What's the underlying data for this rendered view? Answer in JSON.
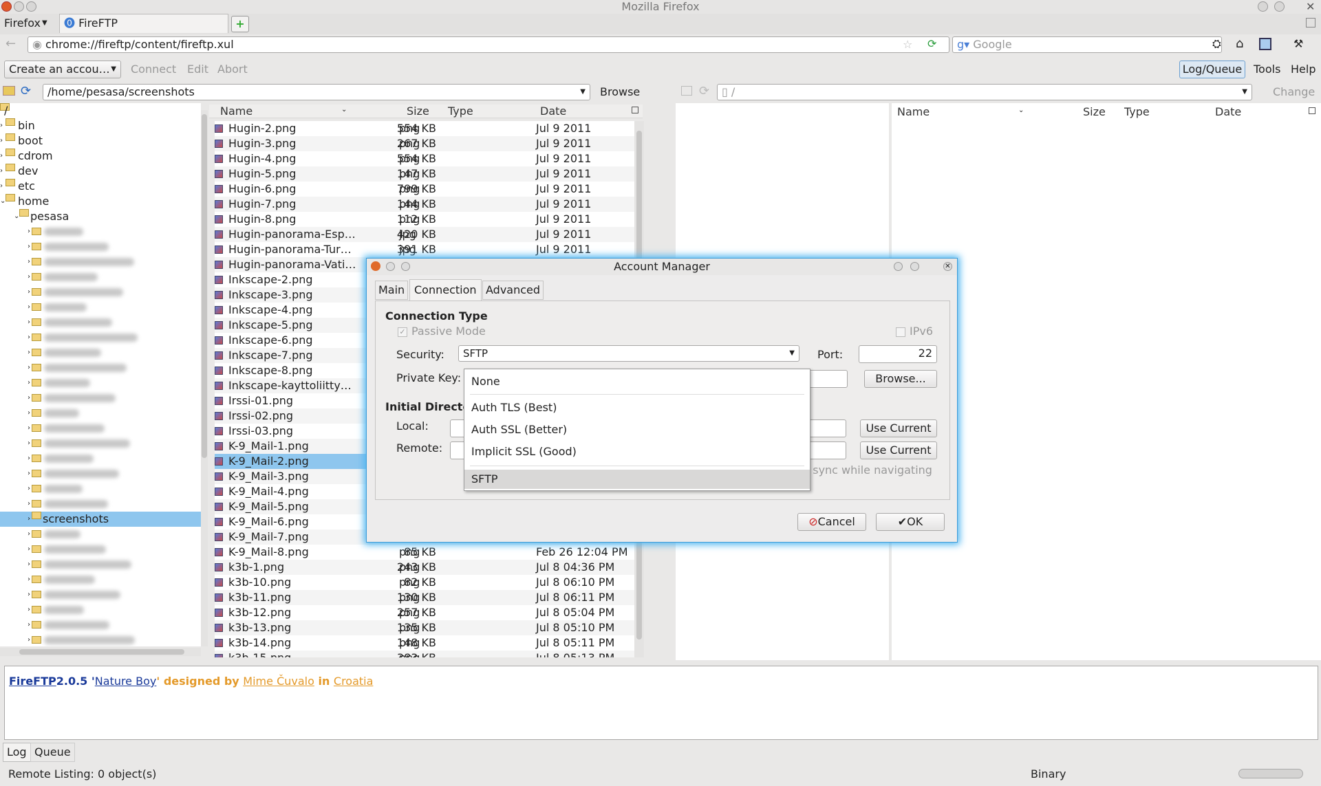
{
  "window": {
    "title": "Mozilla Firefox"
  },
  "browser": {
    "firefox_menu": "Firefox",
    "tab_label": "FireFTP",
    "url": "chrome://fireftp/content/fireftp.xul",
    "search_placeholder": "Google"
  },
  "toolbar": {
    "account_select": "Create an accou…",
    "connect": "Connect",
    "edit": "Edit",
    "abort": "Abort",
    "log_queue": "Log/Queue",
    "tools": "Tools",
    "help": "Help"
  },
  "local": {
    "path": "/home/pesasa/screenshots",
    "browse": "Browse",
    "columns": {
      "name": "Name",
      "size": "Size",
      "type": "Type",
      "date": "Date"
    },
    "tree": {
      "root": "/",
      "bin": "bin",
      "boot": "boot",
      "cdrom": "cdrom",
      "dev": "dev",
      "etc": "etc",
      "home": "home",
      "pesasa": "pesasa",
      "screenshots": "screenshots"
    },
    "files": [
      {
        "name": "Hugin-2.png",
        "size": "554 KB",
        "type": "png",
        "date": "Jul 9 2011"
      },
      {
        "name": "Hugin-3.png",
        "size": "267 KB",
        "type": "png",
        "date": "Jul 9 2011"
      },
      {
        "name": "Hugin-4.png",
        "size": "554 KB",
        "type": "png",
        "date": "Jul 9 2011"
      },
      {
        "name": "Hugin-5.png",
        "size": "147 KB",
        "type": "png",
        "date": "Jul 9 2011"
      },
      {
        "name": "Hugin-6.png",
        "size": "799 KB",
        "type": "png",
        "date": "Jul 9 2011"
      },
      {
        "name": "Hugin-7.png",
        "size": "144 KB",
        "type": "png",
        "date": "Jul 9 2011"
      },
      {
        "name": "Hugin-8.png",
        "size": "112 KB",
        "type": "png",
        "date": "Jul 9 2011"
      },
      {
        "name": "Hugin-panorama-Esp…",
        "size": "420 KB",
        "type": "jpg",
        "date": "Jul 9 2011"
      },
      {
        "name": "Hugin-panorama-Tur…",
        "size": "391 KB",
        "type": "jpg",
        "date": "Jul 9 2011"
      },
      {
        "name": "Hugin-panorama-Vati…",
        "size": "",
        "type": "",
        "date": ""
      },
      {
        "name": "Inkscape-2.png",
        "size": "",
        "type": "",
        "date": ""
      },
      {
        "name": "Inkscape-3.png",
        "size": "",
        "type": "",
        "date": ""
      },
      {
        "name": "Inkscape-4.png",
        "size": "",
        "type": "",
        "date": ""
      },
      {
        "name": "Inkscape-5.png",
        "size": "",
        "type": "",
        "date": ""
      },
      {
        "name": "Inkscape-6.png",
        "size": "",
        "type": "",
        "date": ""
      },
      {
        "name": "Inkscape-7.png",
        "size": "",
        "type": "",
        "date": ""
      },
      {
        "name": "Inkscape-8.png",
        "size": "",
        "type": "",
        "date": ""
      },
      {
        "name": "Inkscape-kayttoliitty…",
        "size": "",
        "type": "",
        "date": ""
      },
      {
        "name": "Irssi-01.png",
        "size": "",
        "type": "",
        "date": ""
      },
      {
        "name": "Irssi-02.png",
        "size": "",
        "type": "",
        "date": ""
      },
      {
        "name": "Irssi-03.png",
        "size": "",
        "type": "",
        "date": ""
      },
      {
        "name": "K-9_Mail-1.png",
        "size": "",
        "type": "",
        "date": ""
      },
      {
        "name": "K-9_Mail-2.png",
        "size": "",
        "type": "",
        "date": ""
      },
      {
        "name": "K-9_Mail-3.png",
        "size": "",
        "type": "",
        "date": ""
      },
      {
        "name": "K-9_Mail-4.png",
        "size": "",
        "type": "",
        "date": ""
      },
      {
        "name": "K-9_Mail-5.png",
        "size": "",
        "type": "",
        "date": ""
      },
      {
        "name": "K-9_Mail-6.png",
        "size": "",
        "type": "",
        "date": ""
      },
      {
        "name": "K-9_Mail-7.png",
        "size": "",
        "type": "",
        "date": ""
      },
      {
        "name": "K-9_Mail-8.png",
        "size": "85 KB",
        "type": "png",
        "date": "Feb 26 12:04 PM"
      },
      {
        "name": "k3b-1.png",
        "size": "243 KB",
        "type": "png",
        "date": "Jul 8 04:36 PM"
      },
      {
        "name": "k3b-10.png",
        "size": "82 KB",
        "type": "png",
        "date": "Jul 8 06:10 PM"
      },
      {
        "name": "k3b-11.png",
        "size": "130 KB",
        "type": "png",
        "date": "Jul 8 06:11 PM"
      },
      {
        "name": "k3b-12.png",
        "size": "257 KB",
        "type": "png",
        "date": "Jul 8 05:04 PM"
      },
      {
        "name": "k3b-13.png",
        "size": "135 KB",
        "type": "png",
        "date": "Jul 8 05:10 PM"
      },
      {
        "name": "k3b-14.png",
        "size": "148 KB",
        "type": "png",
        "date": "Jul 8 05:11 PM"
      },
      {
        "name": "k3b-15.png",
        "size": "383 KB",
        "type": "png",
        "date": "Jul 8 05:13 PM"
      }
    ]
  },
  "remote": {
    "path": "/",
    "change": "Change",
    "columns": {
      "name": "Name",
      "size": "Size",
      "type": "Type",
      "date": "Date"
    }
  },
  "log": {
    "app": "FireFTP",
    "version": "2.0.5 '",
    "codename": "Nature Boy",
    "designed": "' designed by ",
    "author": "Mime Čuvalo",
    "in": " in ",
    "country": "Croatia"
  },
  "bottom_tabs": {
    "log": "Log",
    "queue": "Queue"
  },
  "status": {
    "listing": "Remote Listing: 0 object(s)",
    "mode": "Binary"
  },
  "dialog": {
    "title": "Account Manager",
    "tabs": {
      "main": "Main",
      "connection": "Connection",
      "advanced": "Advanced"
    },
    "connection_type": "Connection Type",
    "passive_mode": "Passive Mode",
    "ipv6": "IPv6",
    "security_label": "Security:",
    "security_value": "SFTP",
    "port_label": "Port:",
    "port_value": "22",
    "private_key_label": "Private Key:",
    "browse": "Browse...",
    "initial_directories": "Initial Director",
    "local_label": "Local:",
    "remote_label": "Remote:",
    "use_current": "Use Current",
    "sync_text": "n sync while navigating",
    "cancel": "Cancel",
    "ok": "OK",
    "security_options": [
      "None",
      "Auth TLS (Best)",
      "Auth SSL (Better)",
      "Implicit SSL (Good)",
      "SFTP"
    ]
  }
}
